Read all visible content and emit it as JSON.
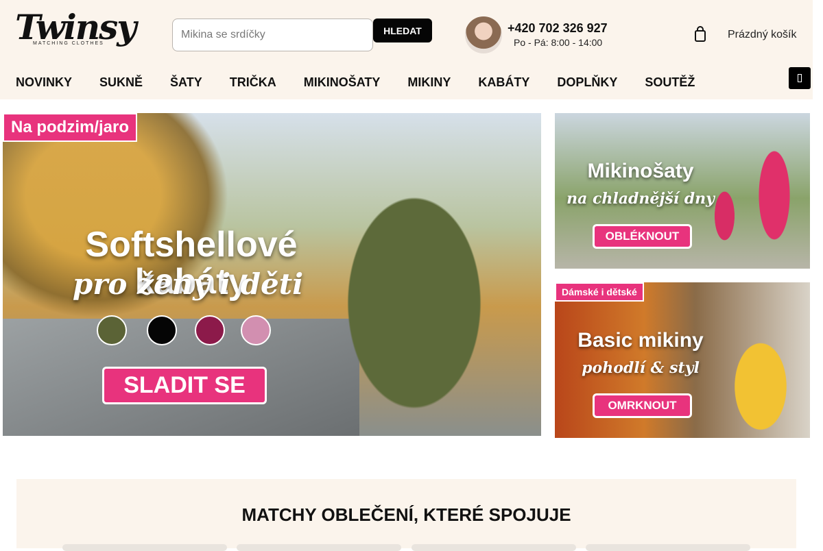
{
  "logo": {
    "wordmark": "Twinsy",
    "tagline": "MATCHING CLOTHES"
  },
  "search": {
    "placeholder": "Mikina se srdíčky",
    "button_label": "HLEDAT"
  },
  "contact": {
    "phone": "+420 702 326 927",
    "hours": "Po - Pá: 8:00 - 14:00"
  },
  "cart": {
    "label": "Prázdný košík"
  },
  "nav": {
    "items": [
      "NOVINKY ",
      "SUKNĚ",
      "ŠATY",
      "TRIČKA",
      "MIKINOŠATY",
      "MIKINY",
      "KABÁTY",
      "DOPLŇKY",
      " SOUTĚŽ"
    ]
  },
  "banners": {
    "main": {
      "tag": "Na podzim/jaro",
      "title": "Softshellové kabáty",
      "subtitle": "pro ženy i děti",
      "cta": "SLADIT SE",
      "swatches": [
        "#5b6336",
        "#050505",
        "#8c1a4a",
        "#d28fb0"
      ]
    },
    "top_side": {
      "title": "Mikinošaty",
      "subtitle": "na chladnější dny",
      "cta": "OBLÉKNOUT"
    },
    "bottom_side": {
      "tag": "Dámské i dětské",
      "title": "Basic mikiny",
      "subtitle": "pohodlí & styl",
      "cta": "OMRKNOUT"
    }
  },
  "promo": {
    "title": " MATCHY OBLEČENÍ, KTERÉ SPOJUJE "
  },
  "colors": {
    "header_bg": "#fbf4ec",
    "accent_pink": "#e8337d",
    "button_black": "#050505"
  }
}
